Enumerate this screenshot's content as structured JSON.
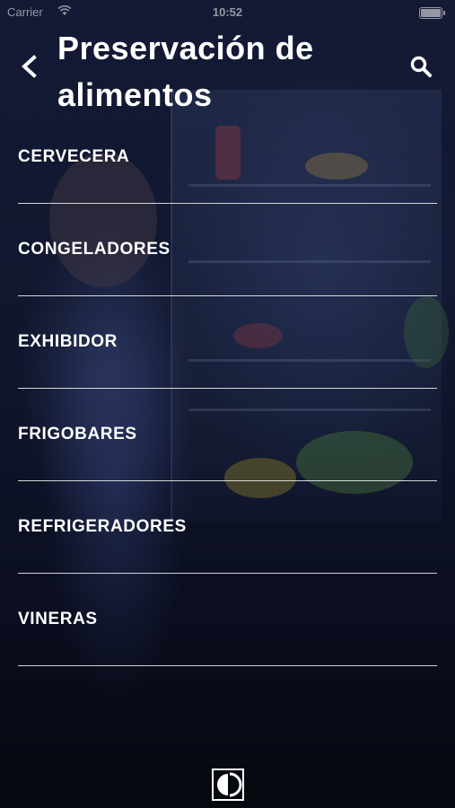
{
  "status_bar": {
    "carrier": "Carrier",
    "time": "10:52",
    "icons": [
      "wifi-icon",
      "battery-icon"
    ]
  },
  "header": {
    "title": "Preservación de alimentos",
    "back_icon": "chevron-left-icon",
    "search_icon": "search-icon"
  },
  "categories": [
    {
      "label": "CERVECERA"
    },
    {
      "label": "CONGELADORES"
    },
    {
      "label": "EXHIBIDOR"
    },
    {
      "label": "FRIGOBARES"
    },
    {
      "label": "REFRIGERADORES"
    },
    {
      "label": "VINERAS"
    }
  ],
  "footer": {
    "logo_icon": "electrolux-logo-icon"
  },
  "colors": {
    "background": "#0b1024",
    "text": "#ffffff",
    "divider": "#d0d0d0"
  }
}
